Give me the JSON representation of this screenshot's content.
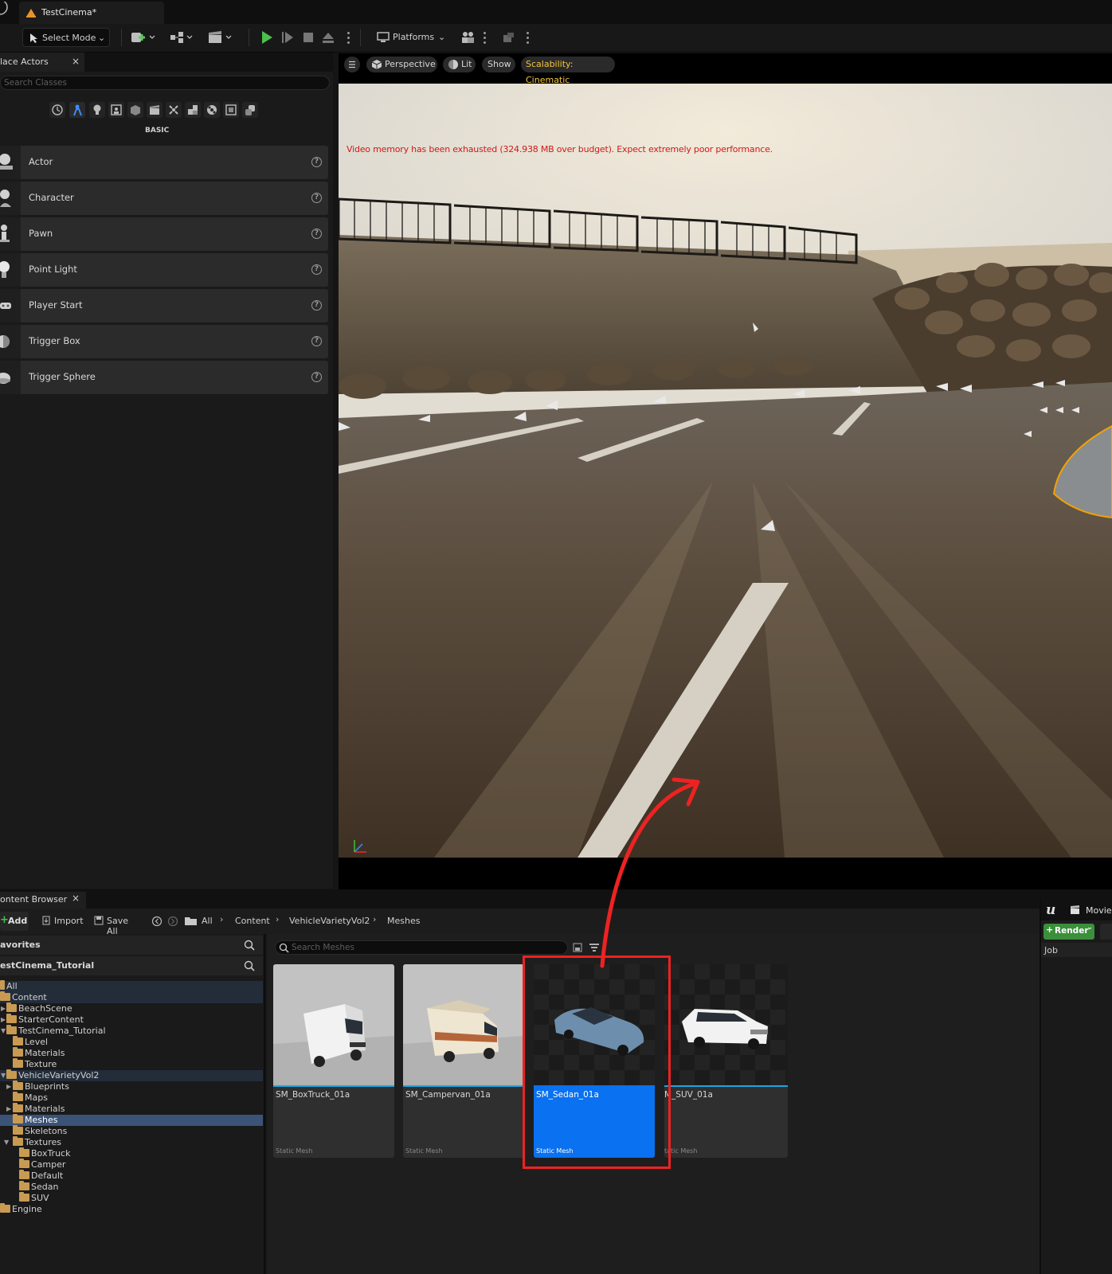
{
  "window": {
    "document_tab": "TestCinema*"
  },
  "toolbar": {
    "select_mode": "Select Mode",
    "platforms": "Platforms"
  },
  "place_actors": {
    "tab_label": "lace Actors",
    "search_placeholder": "Search Classes",
    "category_label": "BASIC",
    "items": [
      {
        "label": "Actor"
      },
      {
        "label": "Character"
      },
      {
        "label": "Pawn"
      },
      {
        "label": "Point Light"
      },
      {
        "label": "Player Start"
      },
      {
        "label": "Trigger Box"
      },
      {
        "label": "Trigger Sphere"
      }
    ]
  },
  "viewport": {
    "perspective": "Perspective",
    "lit": "Lit",
    "show": "Show",
    "scalability": "Scalability: Cinematic",
    "warning": "Video memory has been exhausted (324.938 MB over budget). Expect extremely poor performance."
  },
  "content_browser": {
    "tab_label": "ontent Browser",
    "add": "Add",
    "import": "Import",
    "save_all": "Save All",
    "breadcrumb": [
      "All",
      "Content",
      "VehicleVarietyVol2",
      "Meshes"
    ],
    "search_placeholder": "Search Meshes",
    "favorites": "avorites",
    "project": "estCinema_Tutorial",
    "tree": {
      "all": "All",
      "content": "Content",
      "beach_scene": "BeachScene",
      "starter_content": "StarterContent",
      "testcinema_tutorial": "TestCinema_Tutorial",
      "level": "Level",
      "materials": "Materials",
      "texture": "Texture",
      "vehicle_variety": "VehicleVarietyVol2",
      "blueprints": "Blueprints",
      "maps": "Maps",
      "vv_materials": "Materials",
      "meshes": "Meshes",
      "skeletons": "Skeletons",
      "textures": "Textures",
      "boxtruck": "BoxTruck",
      "camper": "Camper",
      "default": "Default",
      "sedan": "Sedan",
      "suv": "SUV",
      "engine": "Engine"
    },
    "assets": [
      {
        "name": "SM_BoxTruck_01a",
        "type": "Static Mesh"
      },
      {
        "name": "SM_Campervan_01a",
        "type": "Static Mesh"
      },
      {
        "name": "SM_Sedan_01a",
        "type": "Static Mesh"
      },
      {
        "name": "M_SUV_01a",
        "type": "tatic Mesh"
      }
    ]
  },
  "movie_render_queue": {
    "title": "Movie",
    "render_button": "Render",
    "job_column": "Job"
  },
  "colors": {
    "accent_blue": "#0a71f0",
    "annotation_red": "#ee2222",
    "warning_red": "#d01818",
    "scalability_yellow": "#f2c53d",
    "play_green": "#4cc04c"
  }
}
